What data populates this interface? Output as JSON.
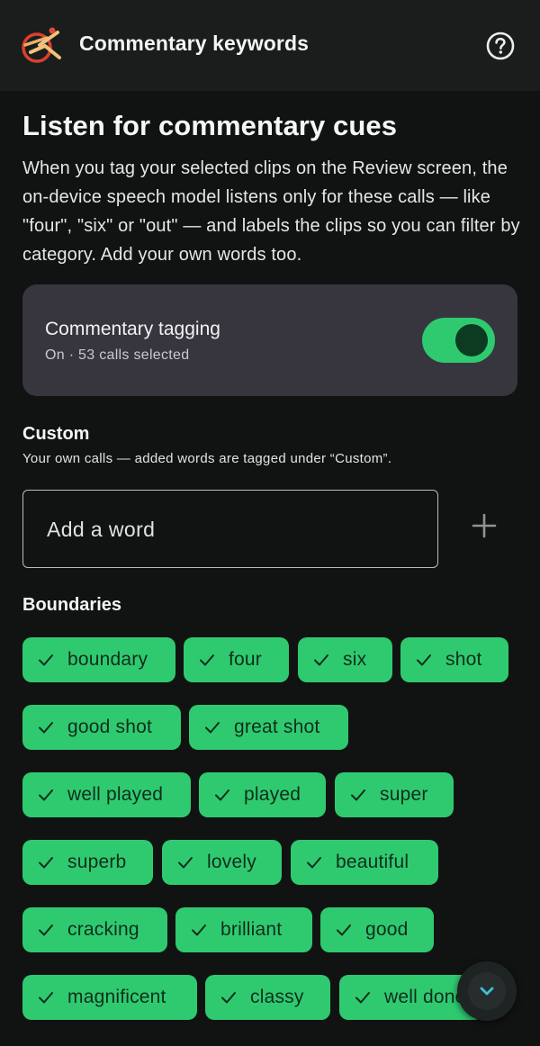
{
  "app_bar": {
    "title": "Commentary keywords",
    "logo_icon": "cricket-ball-bat-logo-icon",
    "help_icon": "help-circle-icon"
  },
  "heading": "Listen for commentary cues",
  "intro": "When you tag your selected clips on the Review screen, the on-device speech model listens only for these calls — like \"four\", \"six\" or \"out\" — and labels the clips so you can filter by category. Add your own words too.",
  "tagging_card": {
    "title": "Commentary tagging",
    "subtitle": "On · 53 calls selected",
    "enabled": true
  },
  "custom": {
    "title": "Custom",
    "description": "Your own calls — added words are tagged under “Custom”.",
    "input_placeholder": "Add a word",
    "input_value": "",
    "add_icon": "plus-icon"
  },
  "boundaries": {
    "title": "Boundaries",
    "chips": [
      {
        "label": "boundary",
        "selected": true
      },
      {
        "label": "four",
        "selected": true
      },
      {
        "label": "six",
        "selected": true
      },
      {
        "label": "shot",
        "selected": true
      },
      {
        "label": "good shot",
        "selected": true
      },
      {
        "label": "great shot",
        "selected": true
      },
      {
        "label": "well played",
        "selected": true
      },
      {
        "label": "played",
        "selected": true
      },
      {
        "label": "super",
        "selected": true
      },
      {
        "label": "superb",
        "selected": true
      },
      {
        "label": "lovely",
        "selected": true
      },
      {
        "label": "beautiful",
        "selected": true
      },
      {
        "label": "cracking",
        "selected": true
      },
      {
        "label": "brilliant",
        "selected": true
      },
      {
        "label": "good",
        "selected": true
      },
      {
        "label": "magnificent",
        "selected": true
      },
      {
        "label": "classy",
        "selected": true
      },
      {
        "label": "well done",
        "selected": true
      }
    ]
  },
  "fab": {
    "icon": "chevron-down-icon"
  },
  "colors": {
    "accent": "#2fca70",
    "chip_text": "#0f2e1b",
    "background": "#111312",
    "card": "#37363e",
    "fab_icon": "#3ec1d6"
  }
}
